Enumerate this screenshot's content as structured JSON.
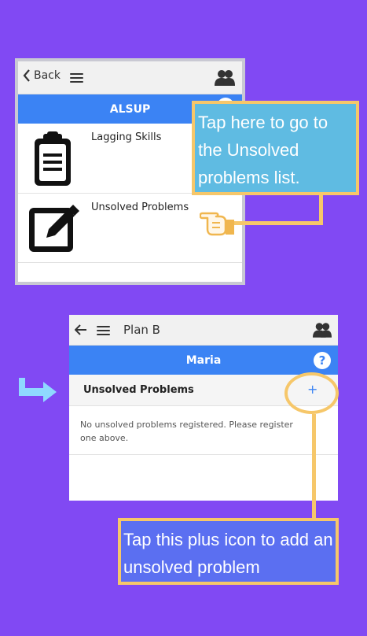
{
  "screen1": {
    "back_label": "Back",
    "title": "ALSUP",
    "rows": [
      {
        "label": "Lagging Skills",
        "icon": "clipboard-icon"
      },
      {
        "label": "Unsolved Problems",
        "icon": "edit-icon"
      }
    ]
  },
  "callout1": {
    "text": "Tap here to go to the Unsolved problems list."
  },
  "screen2": {
    "title": "Plan B",
    "bar_title": "Maria",
    "help_label": "?",
    "section_label": "Unsolved Problems",
    "add_label": "+",
    "empty_message": "No unsolved problems registered. Please register one above."
  },
  "callout2": {
    "text": "Tap this plus icon to add an unsolved problem"
  },
  "colors": {
    "background": "#8149f3",
    "header_blue": "#3b83f4",
    "highlight": "#f6c76a",
    "callout1_fill": "#5fbbe2",
    "callout2_fill": "#5b6ff1",
    "arrow": "#8fd9ff"
  }
}
